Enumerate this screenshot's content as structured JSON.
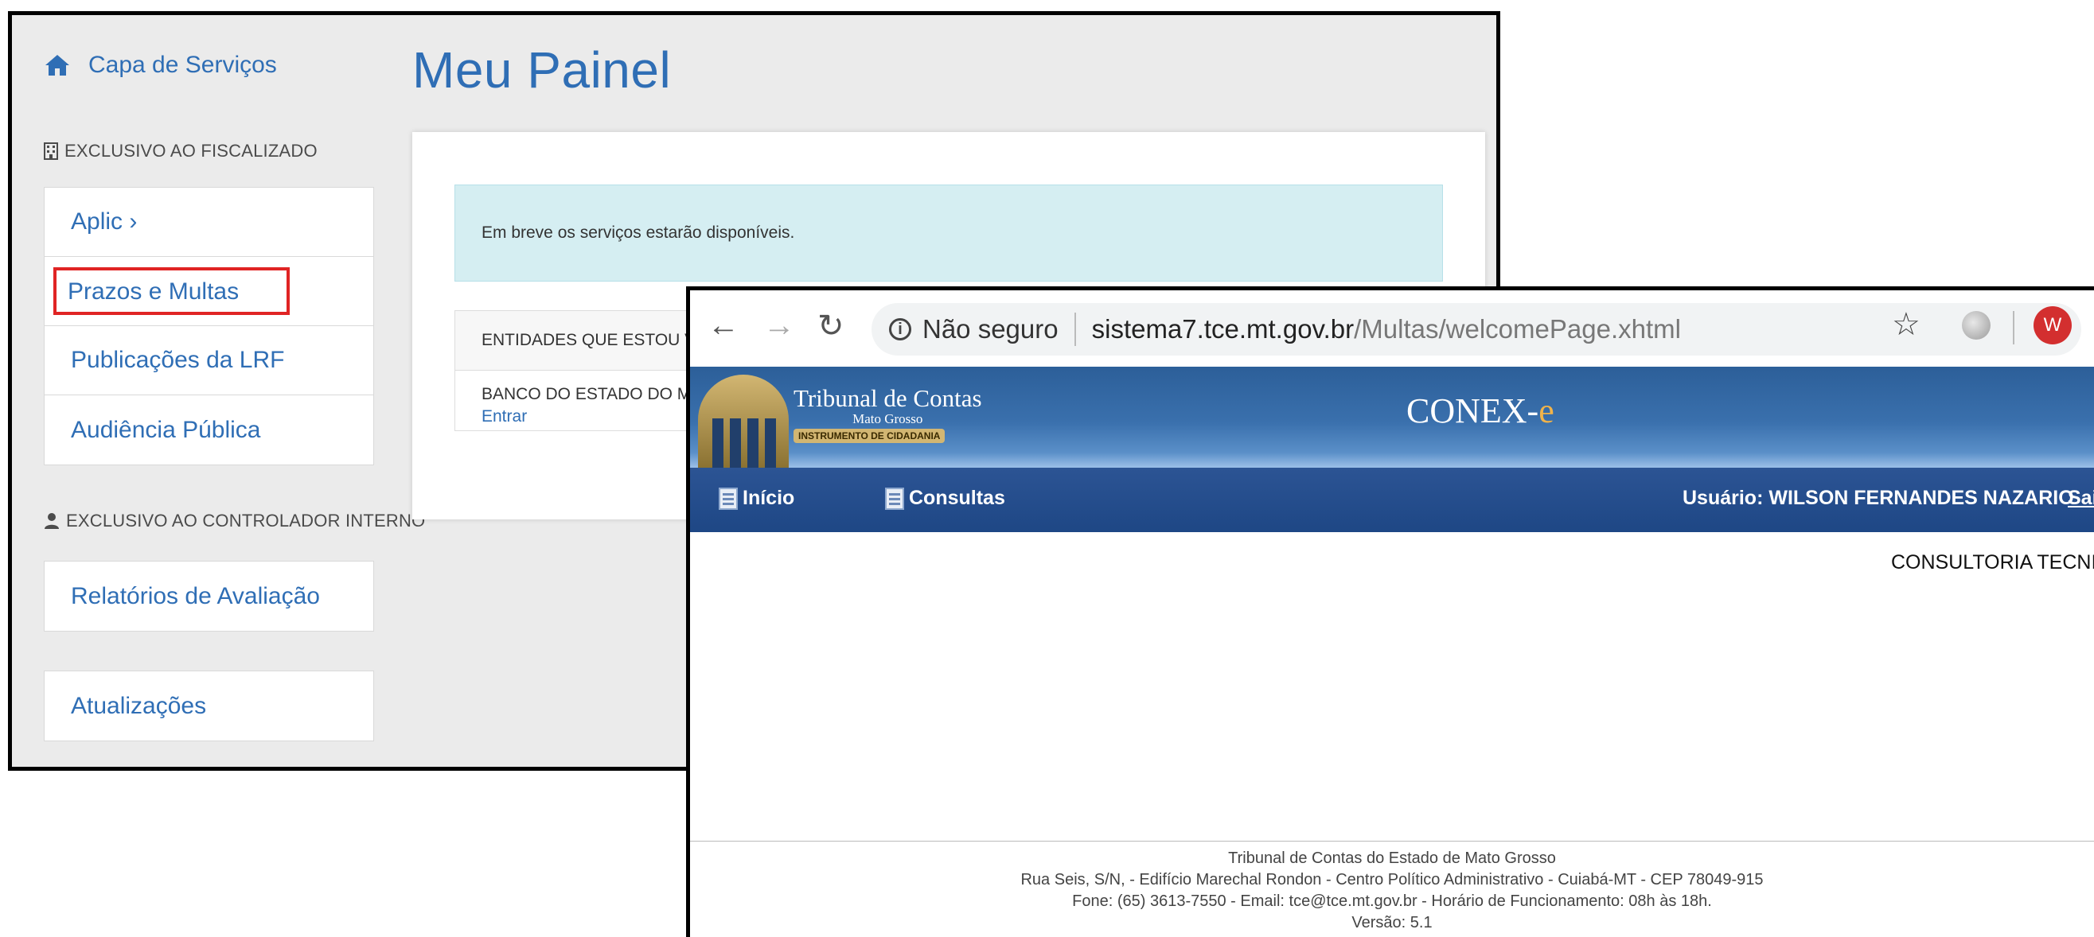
{
  "portal": {
    "home_link": "Capa de Serviços",
    "page_title": "Meu Painel",
    "section_fiscalizado": "EXCLUSIVO AO FISCALIZADO",
    "fiscalizado_items": [
      "Aplic ›",
      "Prazos e Multas",
      "Publicações da LRF",
      "Audiência Pública"
    ],
    "section_controlador": "EXCLUSIVO AO CONTROLADOR INTERNO",
    "controlador_item": "Relatórios de Avaliação",
    "updates_item": "Atualizações",
    "alert_text": "Em breve os serviços estarão disponíveis.",
    "entities_header": "ENTIDADES QUE ESTOU VIN",
    "entity_name": "BANCO DO ESTADO DO MAT",
    "entity_action": "Entrar"
  },
  "browser": {
    "security_label": "Não seguro",
    "url_host": "sistema7.tce.mt.gov.br",
    "url_path": "/Multas/welcomePage.xhtml",
    "avatar_letter": "W"
  },
  "site": {
    "logo_line1": "Tribunal de Contas",
    "logo_line2": "Mato Grosso",
    "logo_line3": "INSTRUMENTO DE CIDADANIA",
    "brand_main": "CONEX-",
    "brand_e": "e",
    "nav_inicio": "Início",
    "nav_consultas": "Consultas",
    "user_info": "Usuário: WILSON FERNANDES NAZARIO",
    "logout": "Sair",
    "department": "CONSULTORIA TECNICA",
    "footer": [
      "Tribunal de Contas do Estado de Mato Grosso",
      "Rua Seis, S/N, - Edifício Marechal Rondon - Centro Político Administrativo - Cuiabá-MT - CEP 78049-915",
      "Fone: (65) 3613-7550 - Email: tce@tce.mt.gov.br - Horário de Funcionamento: 08h às 18h.",
      "Versão: 5.1"
    ]
  },
  "colors": {
    "link_blue": "#2f6eb5",
    "highlight_red": "#e02424",
    "navbar_blue": "#1e4785",
    "alert_bg": "#d5eef2",
    "brand_accent": "#f0b34a"
  },
  "icons": [
    "home-icon",
    "building-icon",
    "user-icon",
    "back-arrow-icon",
    "forward-arrow-icon",
    "reload-icon",
    "info-icon",
    "star-icon",
    "extension-icon",
    "document-icon"
  ]
}
